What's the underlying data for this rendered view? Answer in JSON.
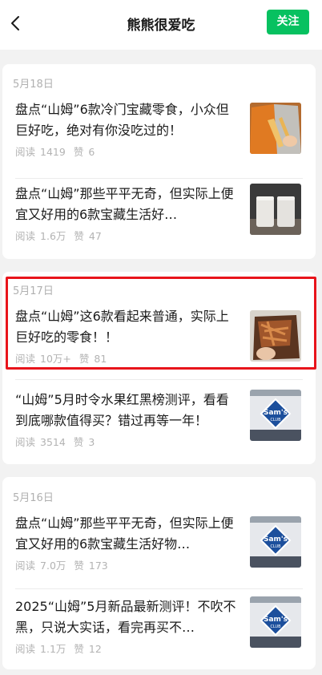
{
  "header": {
    "title": "熊熊很爱吃",
    "follow_label": "关注"
  },
  "groups": [
    {
      "date": "5月18日",
      "articles": [
        {
          "title": "盘点“山姆”6款冷门宝藏零食，小众但巨好吃，绝对有你没吃过的！",
          "read_label": "阅读",
          "reads": "1419",
          "like_label": "赞",
          "likes": "6",
          "thumb": "snack-bag-photo"
        },
        {
          "title": "盘点“山姆”那些平平无奇，但实际上便宜又好用的6款宝藏生活好…",
          "read_label": "阅读",
          "reads": "1.6万",
          "like_label": "赞",
          "likes": "47",
          "thumb": "trash-bins-photo"
        }
      ]
    },
    {
      "date": "5月17日",
      "articles": [
        {
          "title": "盘点“山姆”这6款看起来普通，实际上巨好吃的零食！！",
          "read_label": "阅读",
          "reads": "10万+",
          "like_label": "赞",
          "likes": "81",
          "thumb": "dried-meat-bag-photo"
        },
        {
          "title": "“山姆”5月时令水果红黑榜测评，看看到底哪款值得买？错过再等一年！",
          "read_label": "阅读",
          "reads": "3514",
          "like_label": "赞",
          "likes": "3",
          "thumb": "sams-club-storefront-photo"
        }
      ]
    },
    {
      "date": "5月16日",
      "articles": [
        {
          "title": "盘点“山姆”那些平平无奇，但实际上便宜又好用的6款宝藏生活好物…",
          "read_label": "阅读",
          "reads": "7.0万",
          "like_label": "赞",
          "likes": "173",
          "thumb": "sams-club-storefront-photo"
        },
        {
          "title": "2025“山姆”5月新品最新测评！不吹不黑，只说大实话，看完再买不…",
          "read_label": "阅读",
          "reads": "1.1万",
          "like_label": "赞",
          "likes": "12",
          "thumb": "sams-club-storefront-photo"
        }
      ]
    }
  ],
  "logo_text": {
    "brand": "Sam's",
    "sub": "CLUB"
  },
  "colors": {
    "follow_bg": "#07c160",
    "highlight": "#e8141b",
    "page_bg": "#f2f2f2",
    "sams_blue": "#1c4f9c"
  }
}
